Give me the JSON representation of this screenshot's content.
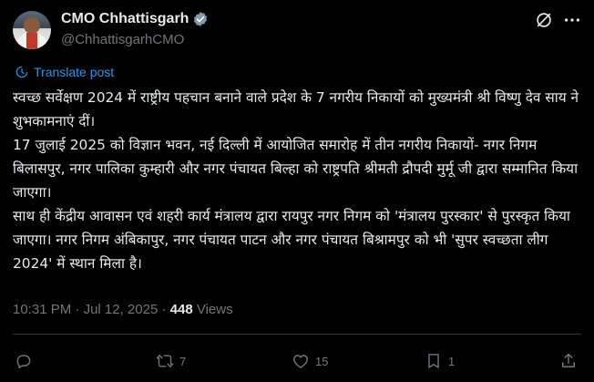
{
  "author": {
    "display_name": "CMO Chhattisgarh",
    "handle": "@ChhattisgarhCMO",
    "verified": true
  },
  "translate_label": "Translate post",
  "post": {
    "paragraphs": [
      "स्वच्छ सर्वेक्षण 2024 में राष्ट्रीय पहचान बनाने वाले प्रदेश के 7 नगरीय निकायों को मुख्यमंत्री श्री विष्णु देव साय ने शुभकामनाएं दीं।",
      "17 जुलाई 2025 को विज्ञान भवन, नई दिल्ली में आयोजित समारोह में तीन नगरीय निकायों- नगर निगम बिलासपुर, नगर पालिका कुम्हारी और नगर पंचायत बिल्हा को राष्ट्रपति श्रीमती द्रौपदी मुर्मू जी द्वारा सम्मानित किया जाएगा।",
      "साथ ही केंद्रीय आवासन एवं शहरी कार्य मंत्रालय द्वारा रायपुर नगर निगम को 'मंत्रालय पुरस्कार' से पुरस्कृत किया जाएगा। नगर निगम अंबिकापुर, नगर पंचायत पाटन और नगर पंचायत बिश्रामपुर को भी 'सुपर स्वच्छता लीग 2024' में स्थान मिला है।"
    ]
  },
  "meta": {
    "time": "10:31 PM",
    "separator": "·",
    "date": "Jul 12, 2025",
    "views_count": "448",
    "views_label": "Views"
  },
  "actions": {
    "replies": "",
    "reposts": "7",
    "likes": "15",
    "bookmarks": "1"
  },
  "colors": {
    "background": "#000000",
    "text": "#e7e9ea",
    "secondary": "#71767b",
    "accent": "#1d9bf0",
    "divider": "#2f3336"
  }
}
